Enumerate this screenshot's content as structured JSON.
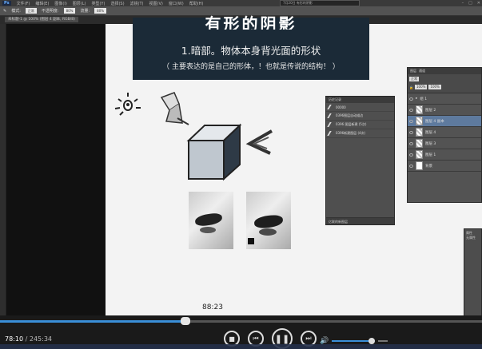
{
  "app": {
    "logo": "Ps",
    "menu": [
      "文件(F)",
      "编辑(E)",
      "图像(I)",
      "图层(L)",
      "类型(Y)",
      "选择(S)",
      "滤镜(T)",
      "视图(V)",
      "窗口(W)",
      "帮助(H)"
    ],
    "title_box": "7月20日 有形的阴影"
  },
  "options_bar": {
    "mode_label": "模式:",
    "mode_value": "正常",
    "opacity_label": "不透明度:",
    "opacity_value": "80%",
    "flow_label": "流量:",
    "flow_value": "80%"
  },
  "document_tab": "未标题-1 @ 100% (图层 4 副本, RGB/8)",
  "slide": {
    "title": "有形的阴影",
    "point": "1.暗部。物体本身背光面的形状",
    "note": "（ 主要表达的是自己的形体，！也就是传说的结构！ ）"
  },
  "hover_time": "88:23",
  "history_panel": {
    "title": "历史记录",
    "items": [
      "00000",
      "0396图层自动描边",
      "0396 图层新建 (5次)",
      "0396新建图层 (4次)"
    ],
    "footer": "亿联的新图层"
  },
  "layers_panel": {
    "tabs": [
      "图层",
      "通道"
    ],
    "blend_mode": "正常",
    "opacity": "100%",
    "fill": "100%",
    "layers": [
      {
        "name": "组 1",
        "type": "group"
      },
      {
        "name": "图层 2",
        "type": "normal"
      },
      {
        "name": "图层 4 副本",
        "type": "normal"
      },
      {
        "name": "图层 4",
        "type": "normal"
      },
      {
        "name": "图层 3",
        "type": "normal"
      },
      {
        "name": "图层 1",
        "type": "normal"
      },
      {
        "name": "背景",
        "type": "background"
      }
    ],
    "selected_index": 2
  },
  "properties_panel": {
    "title": "属性",
    "text": "无属性"
  },
  "player": {
    "current_time": "78:10",
    "total_time": "245:34",
    "progress": 0.385,
    "volume": 0.82,
    "accent": "#3a8fd8"
  },
  "icons": [
    "stop-icon",
    "previous-icon",
    "pause-icon",
    "next-icon",
    "volume-icon"
  ]
}
